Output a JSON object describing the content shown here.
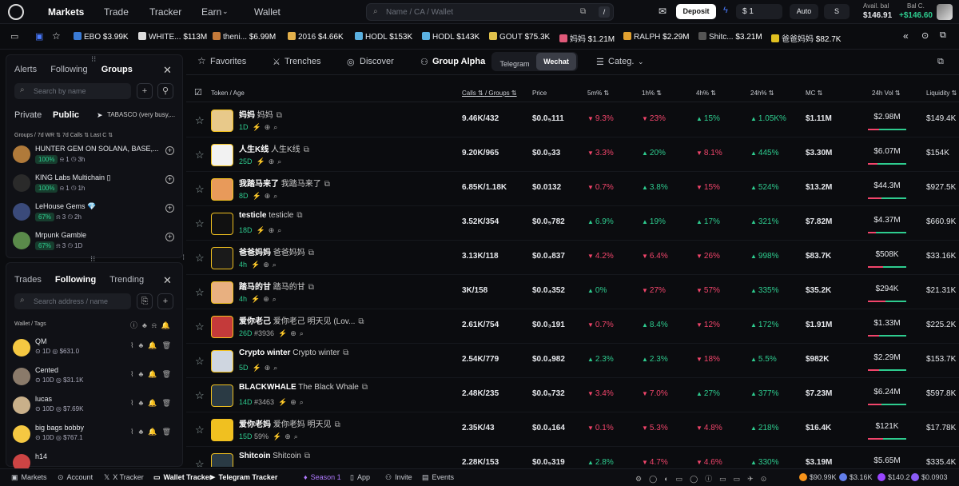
{
  "topbar": {
    "nav": [
      "Markets",
      "Trade",
      "Tracker",
      "Earn",
      "Wallet"
    ],
    "search_placeholder": "Name / CA / Wallet",
    "shortcut": "/",
    "deposit": "Deposit",
    "amount": "$ 1",
    "auto": "Auto",
    "s_label": "S",
    "avail_label": "Avail. bal",
    "avail_value": "$146.91",
    "balc_label": "Bal C.",
    "balc_value": "+$146.60"
  },
  "ticker": [
    {
      "name": "EBO",
      "value": "$3.99K",
      "color": "#3a7bd5"
    },
    {
      "name": "WHITE...",
      "value": "$113M",
      "color": "#ddd"
    },
    {
      "name": "theni...",
      "value": "$6.99M",
      "color": "#c47a3a"
    },
    {
      "name": "2016",
      "value": "$4.66K",
      "color": "#e3b04b"
    },
    {
      "name": "HODL",
      "value": "$153K",
      "color": "#5ab0e0"
    },
    {
      "name": "HODL",
      "value": "$143K",
      "color": "#5ab0e0"
    },
    {
      "name": "GOUT",
      "value": "$75.3K",
      "color": "#e0c14b"
    },
    {
      "name": "妈妈",
      "value": "$1.21M",
      "color": "#e05a7a"
    },
    {
      "name": "RALPH",
      "value": "$2.29M",
      "color": "#e0a030"
    },
    {
      "name": "Shitc...",
      "value": "$3.21M",
      "color": "#555"
    },
    {
      "name": "爸爸妈妈",
      "value": "$82.7K",
      "color": "#e0c020"
    }
  ],
  "groups_panel": {
    "tabs": [
      "Alerts",
      "Following",
      "Groups"
    ],
    "active_tab": "Groups",
    "search_placeholder": "Search by name",
    "subtabs": [
      "Private",
      "Public"
    ],
    "active_subtab": "Public",
    "notice": "TABASCO (very busy,...",
    "columns": [
      "Groups",
      "7d WR",
      "7d Calls",
      "Last C"
    ],
    "items": [
      {
        "name": "HUNTER GEM ON SOLANA, BASE,...",
        "wr": "100%",
        "calls": "1",
        "last": "3h",
        "color": "#b07a3a"
      },
      {
        "name": "KING Labs Multichain ▯",
        "wr": "100%",
        "calls": "1",
        "last": "1h",
        "color": "#2a2a2a"
      },
      {
        "name": "LeHouse Gems 💎",
        "wr": "67%",
        "calls": "3",
        "last": "2h",
        "color": "#3a4a7a"
      },
      {
        "name": "Mrpunk Gamble",
        "wr": "67%",
        "calls": "3",
        "last": "1D",
        "color": "#5a8a4a"
      }
    ]
  },
  "wallet_panel": {
    "tabs": [
      "Trades",
      "Following",
      "Trending"
    ],
    "active_tab": "Following",
    "search_placeholder": "Search address / name",
    "header": "Wallet / Tags",
    "items": [
      {
        "name": "QM",
        "count": "1D",
        "value": "$631.0",
        "color": "#f5c842"
      },
      {
        "name": "Cented",
        "count": "10D",
        "value": "$31.1K",
        "color": "#8a7a6a"
      },
      {
        "name": "lucas",
        "count": "10D",
        "value": "$7.69K",
        "color": "#c9b08a"
      },
      {
        "name": "big bags bobby",
        "count": "10D",
        "value": "$767.1",
        "color": "#f5c842"
      },
      {
        "name": "h14",
        "count": "",
        "value": "",
        "color": "#c44"
      }
    ]
  },
  "main_tabs": {
    "tabs": [
      "Favorites",
      "Trenches",
      "Discover",
      "Group Alpha"
    ],
    "active": "Group Alpha",
    "seg": [
      "Telegram",
      "Wechat"
    ],
    "seg_active": "Wechat",
    "category": "Categ."
  },
  "table": {
    "headers": [
      "Token",
      "/",
      "Age",
      "Calls",
      "/",
      "Groups",
      "Price",
      "5m%",
      "1h%",
      "4h%",
      "24h%",
      "MC",
      "24h Vol",
      "Liquidity"
    ],
    "rows": [
      {
        "sym": "妈妈",
        "name": "妈妈",
        "age": "1D",
        "calls": "9.46K/432",
        "price": "$0.0₅111",
        "m5": "9.3%",
        "m5d": "down",
        "h1": "23%",
        "h1d": "down",
        "h4": "15%",
        "h4d": "up",
        "h24": "1.05K%",
        "h24d": "up",
        "mc": "$1.11M",
        "vol": "$2.98M",
        "vr": 0.3,
        "liq": "$149.4K",
        "img": "#e8c98a",
        "extra": ""
      },
      {
        "sym": "人生K线",
        "name": "人生K线",
        "age": "25D",
        "calls": "9.20K/965",
        "price": "$0.0₅33",
        "m5": "3.3%",
        "m5d": "down",
        "h1": "20%",
        "h1d": "up",
        "h4": "8.1%",
        "h4d": "down",
        "h24": "445%",
        "h24d": "up",
        "mc": "$3.30M",
        "vol": "$6.07M",
        "vr": 0.25,
        "liq": "$154K",
        "img": "#f2f2f2",
        "extra": ""
      },
      {
        "sym": "我踏马来了",
        "name": "我踏马来了",
        "age": "8D",
        "calls": "6.85K/1.18K",
        "price": "$0.0132",
        "m5": "0.7%",
        "m5d": "down",
        "h1": "3.8%",
        "h1d": "up",
        "h4": "15%",
        "h4d": "down",
        "h24": "524%",
        "h24d": "up",
        "mc": "$13.2M",
        "vol": "$44.3M",
        "vr": 0.35,
        "liq": "$927.5K",
        "img": "#e89a5a",
        "extra": ""
      },
      {
        "sym": "testicle",
        "name": "testicle",
        "age": "18D",
        "calls": "3.52K/354",
        "price": "$0.0₅782",
        "m5": "6.9%",
        "m5d": "up",
        "h1": "19%",
        "h1d": "up",
        "h4": "17%",
        "h4d": "up",
        "h24": "321%",
        "h24d": "up",
        "mc": "$7.82M",
        "vol": "$4.37M",
        "vr": 0.2,
        "liq": "$660.9K",
        "img": "#111",
        "extra": ""
      },
      {
        "sym": "爸爸妈妈",
        "name": "爸爸妈妈",
        "age": "4h",
        "calls": "3.13K/118",
        "price": "$0.0₄837",
        "m5": "4.2%",
        "m5d": "down",
        "h1": "6.4%",
        "h1d": "down",
        "h4": "26%",
        "h4d": "down",
        "h24": "998%",
        "h24d": "up",
        "mc": "$83.7K",
        "vol": "$508K",
        "vr": 0.4,
        "liq": "$33.16K",
        "img": "#1a1a1a",
        "extra": ""
      },
      {
        "sym": "踏马的甘",
        "name": "踏马的甘",
        "age": "4h",
        "calls": "3K/158",
        "price": "$0.0₄352",
        "m5": "0%",
        "m5d": "up",
        "h1": "27%",
        "h1d": "down",
        "h4": "57%",
        "h4d": "down",
        "h24": "335%",
        "h24d": "up",
        "mc": "$35.2K",
        "vol": "$294K",
        "vr": 0.45,
        "liq": "$21.31K",
        "img": "#e8b080",
        "extra": ""
      },
      {
        "sym": "爱你老己",
        "name": "爱你老己 明天见 (Lov...",
        "age": "26D",
        "calls": "2.61K/754",
        "price": "$0.0₃191",
        "m5": "0.7%",
        "m5d": "down",
        "h1": "8.4%",
        "h1d": "up",
        "h4": "12%",
        "h4d": "down",
        "h24": "172%",
        "h24d": "up",
        "mc": "$1.91M",
        "vol": "$1.33M",
        "vr": 0.3,
        "liq": "$225.2K",
        "img": "#c43a3a",
        "extra": "#3936"
      },
      {
        "sym": "Crypto winter",
        "name": "Crypto winter",
        "age": "5D",
        "calls": "2.54K/779",
        "price": "$0.0₄982",
        "m5": "2.3%",
        "m5d": "up",
        "h1": "2.3%",
        "h1d": "up",
        "h4": "18%",
        "h4d": "down",
        "h24": "5.5%",
        "h24d": "up",
        "mc": "$982K",
        "vol": "$2.29M",
        "vr": 0.3,
        "liq": "$153.7K",
        "img": "#cfd6e0",
        "extra": ""
      },
      {
        "sym": "BLACKWHALE",
        "name": "The Black Whale",
        "age": "14D",
        "calls": "2.48K/235",
        "price": "$0.0₅732",
        "m5": "3.4%",
        "m5d": "down",
        "h1": "7.0%",
        "h1d": "down",
        "h4": "27%",
        "h4d": "up",
        "h24": "377%",
        "h24d": "up",
        "mc": "$7.23M",
        "vol": "$6.24M",
        "vr": 0.35,
        "liq": "$597.8K",
        "img": "#2a3a44",
        "extra": "#3463"
      },
      {
        "sym": "爱你老妈",
        "name": "爱你老妈 明天见",
        "age": "15D",
        "calls": "2.35K/43",
        "price": "$0.0₄164",
        "m5": "0.1%",
        "m5d": "down",
        "h1": "5.3%",
        "h1d": "down",
        "h4": "4.8%",
        "h4d": "down",
        "h24": "218%",
        "h24d": "up",
        "mc": "$16.4K",
        "vol": "$121K",
        "vr": 0.4,
        "liq": "$17.78K",
        "img": "#f0c020",
        "extra": "59%"
      },
      {
        "sym": "Shitcoin",
        "name": "Shitcoin",
        "age": "",
        "calls": "2.28K/153",
        "price": "$0.0₅319",
        "m5": "2.8%",
        "m5d": "up",
        "h1": "4.7%",
        "h1d": "down",
        "h4": "4.6%",
        "h4d": "down",
        "h24": "330%",
        "h24d": "up",
        "mc": "$3.19M",
        "vol": "$5.65M",
        "vr": 0.3,
        "liq": "$335.4K",
        "img": "#2a3a44",
        "extra": ""
      }
    ]
  },
  "bottombar": {
    "items": [
      "Markets",
      "Account",
      "X Tracker",
      "Wallet Tracker",
      "Telegram Tracker",
      "Season 1",
      "App",
      "Invite",
      "Events"
    ],
    "prices": [
      {
        "v": "$90.99K",
        "c": "#f7931a"
      },
      {
        "v": "$3.16K",
        "c": "#627eea"
      },
      {
        "v": "$140.2",
        "c": "#9945ff"
      },
      {
        "v": "$0.0903",
        "c": "#8a5cf6"
      }
    ]
  }
}
